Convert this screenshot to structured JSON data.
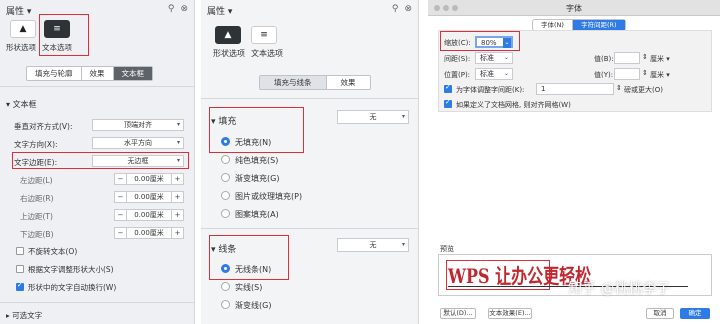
{
  "panel1": {
    "header_title": "属性",
    "tab_shape": "形状选项",
    "tab_text": "文本选项",
    "subtabs": [
      "填充与轮廓",
      "效果",
      "文本框"
    ],
    "section_title": "文本框",
    "rows": [
      {
        "label": "垂直对齐方式(V):",
        "value": "顶端对齐"
      },
      {
        "label": "文字方向(X):",
        "value": "水平方向"
      },
      {
        "label": "文字边距(E):",
        "value": "无边框"
      }
    ],
    "margins": [
      {
        "label": "左边距(L)",
        "value": "0.00厘米"
      },
      {
        "label": "右边距(R)",
        "value": "0.00厘米"
      },
      {
        "label": "上边距(T)",
        "value": "0.00厘米"
      },
      {
        "label": "下边距(B)",
        "value": "0.00厘米"
      }
    ],
    "checks": [
      "不旋转文本(O)",
      "根据文字调整形状大小(S)",
      "形状中的文字自动换行(W)"
    ],
    "footer": "可选文字"
  },
  "panel2": {
    "header_title": "属性",
    "tab_shape": "形状选项",
    "tab_text": "文本选项",
    "subtabs": [
      "填充与线条",
      "效果"
    ],
    "fill_title": "填充",
    "fill_select": "无",
    "fill_options": [
      "无填充(N)",
      "纯色填充(S)",
      "渐变填充(G)",
      "图片或纹理填充(P)",
      "图案填充(A)"
    ],
    "line_title": "线条",
    "line_select": "无",
    "line_options": [
      "无线条(N)",
      "实线(S)",
      "渐变线(G)"
    ]
  },
  "panel3": {
    "window_title": "字体",
    "tabs": [
      "字体(N)",
      "字符间距(R)"
    ],
    "scale_label": "缩放(C):",
    "scale_value": "80%",
    "spacing_label": "间距(S):",
    "spacing_value": "标准",
    "spacing_amount_label": "值(B):",
    "position_label": "位置(P):",
    "position_value": "标准",
    "position_amount_label": "值(Y):",
    "unit": "厘米",
    "kerning_label": "为字体调整字间距(K):",
    "kerning_value": "1",
    "kerning_suffix": "磅或更大(O)",
    "grid_label": "如果定义了文档网格, 则对齐网格(W)",
    "preview_label": "预览",
    "preview_text": "WPS 让办公更轻松",
    "watermark": "知乎 @桃桃李子",
    "buttons": [
      "默认(D)...",
      "文本效果(E)...",
      "取消",
      "确定"
    ]
  }
}
